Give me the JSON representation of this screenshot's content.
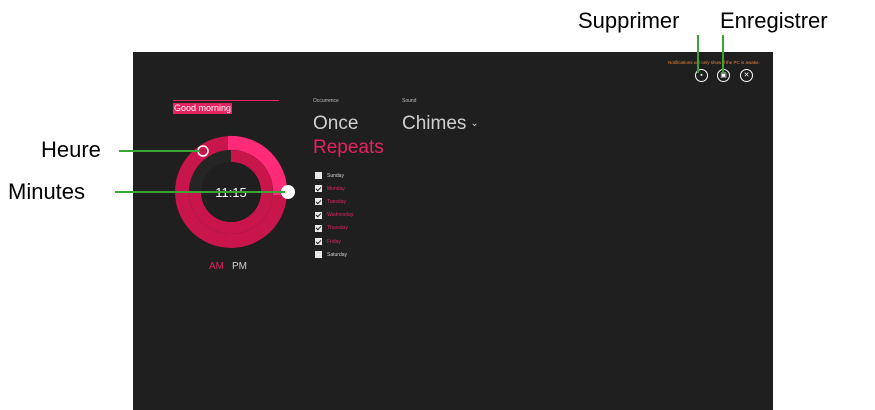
{
  "callouts": {
    "supprimer": "Supprimer",
    "enregistrer": "Enregistrer",
    "heure": "Heure",
    "minutes": "Minutes"
  },
  "alarm": {
    "name": "Good morning",
    "time": "11:15",
    "am_label": "AM",
    "pm_label": "PM",
    "selected_period": "AM",
    "hour_value": 11,
    "minute_value": 15
  },
  "occurrence": {
    "label": "Occurrence",
    "once": "Once",
    "repeats": "Repeats",
    "selected": "Repeats",
    "days": [
      {
        "name": "Sunday",
        "checked": false
      },
      {
        "name": "Monday",
        "checked": true
      },
      {
        "name": "Tuesday",
        "checked": true
      },
      {
        "name": "Wednesday",
        "checked": true
      },
      {
        "name": "Thursday",
        "checked": true
      },
      {
        "name": "Friday",
        "checked": true
      },
      {
        "name": "Saturday",
        "checked": false
      }
    ]
  },
  "sound": {
    "label": "Sound",
    "value": "Chimes"
  },
  "toolbar": {
    "notification": "Notifications will only show if the PC is awake.",
    "delete_icon": "trash-icon",
    "save_icon": "save-icon",
    "close_icon": "close-icon"
  },
  "colors": {
    "accent": "#e5235f",
    "accent_dark": "#c8164c",
    "background": "#1f1f1f",
    "notification": "#e5823c",
    "leader": "#3aa535"
  }
}
